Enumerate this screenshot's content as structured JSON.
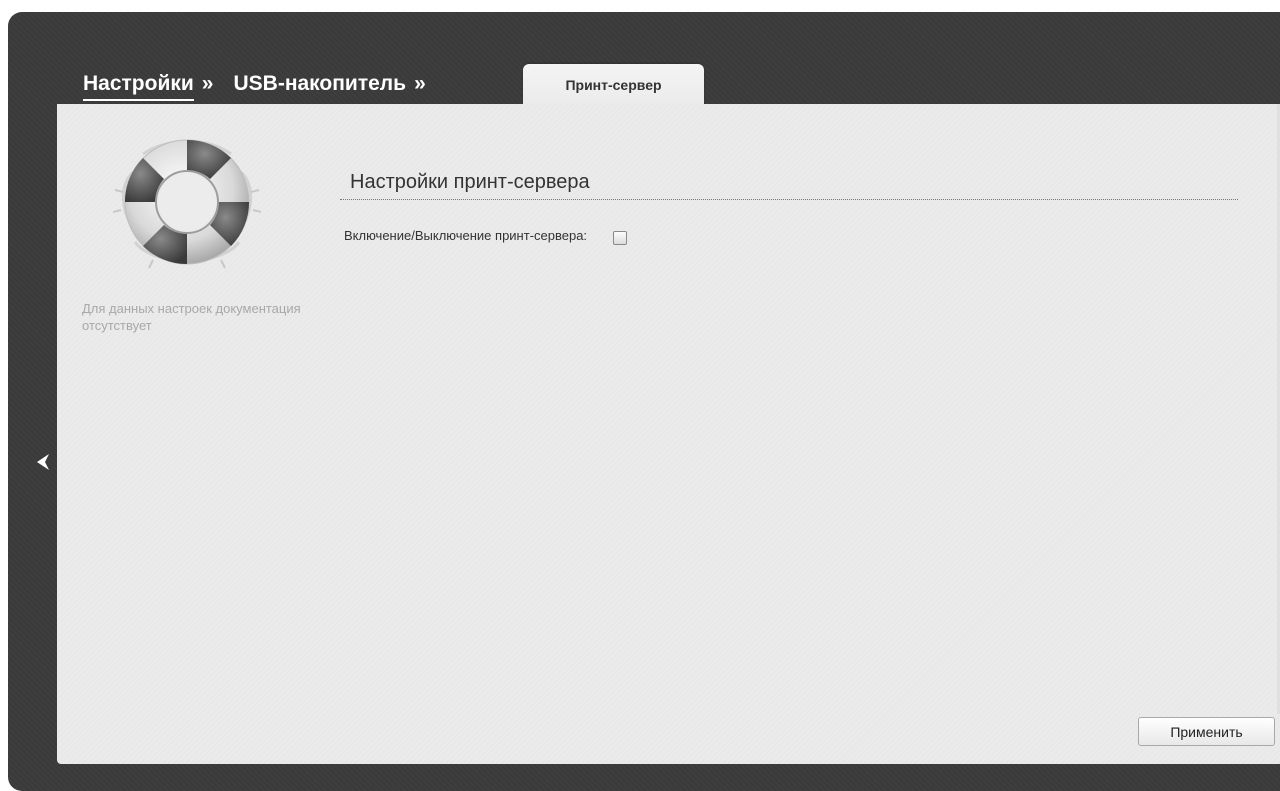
{
  "breadcrumb": {
    "level1": "Настройки",
    "level2": "USB-накопитель",
    "separator": "»"
  },
  "tab": {
    "label": "Принт-сервер"
  },
  "help": {
    "icon": "lifebuoy-icon",
    "text": "Для данных настроек документация отсутствует"
  },
  "section": {
    "title": "Настройки принт-сервера",
    "field_label": "Включение/Выключение принт-сервера:",
    "enabled": false
  },
  "actions": {
    "apply_label": "Применить"
  },
  "nav": {
    "back_icon": "chevron-left-icon"
  },
  "colors": {
    "frame": "#3b3b3b",
    "panel": "#ebebeb",
    "text": "#333333",
    "muted": "#a8a8a8"
  }
}
